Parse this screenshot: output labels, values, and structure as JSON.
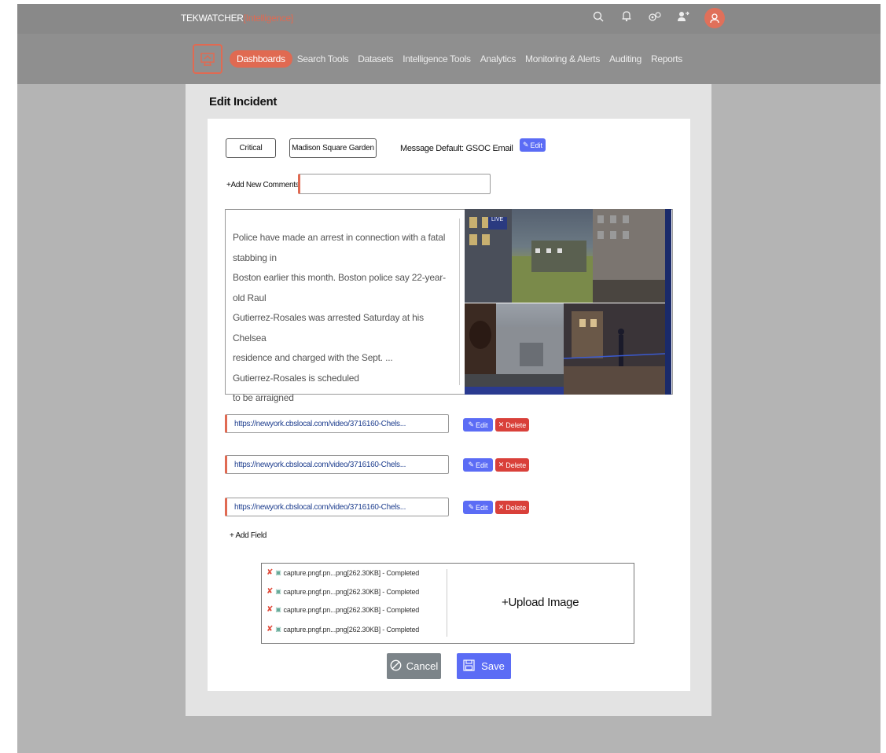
{
  "app": {
    "brand": "TEKWATCHER",
    "brand_suffix": "[Intelligence]"
  },
  "top_icons": [
    "search-icon",
    "bell-icon",
    "settings-icon",
    "user-switch-icon",
    "user-avatar-icon"
  ],
  "nav": {
    "items": [
      {
        "label": "Dashboards",
        "active": true
      },
      {
        "label": "Search Tools"
      },
      {
        "label": "Datasets"
      },
      {
        "label": "Intelligence Tools"
      },
      {
        "label": "Analytics"
      },
      {
        "label": "Monitoring & Alerts"
      },
      {
        "label": "Auditing"
      },
      {
        "label": "Reports"
      }
    ]
  },
  "page": {
    "title": "Edit Incident"
  },
  "incident": {
    "severity": "Critical",
    "location": "Madison Square Garden",
    "message_default": "Message Default: GSOC Email",
    "edit_label": "Edit",
    "add_comments_label": "Add New Comments",
    "comment_value": "",
    "news_lines": [
      "Police have made an arrest in connection with a fatal stabbing in",
      "Boston earlier this month. Boston police say 22-year-old Raul",
      "Gutierrez-Rosales was arrested Saturday at his Chelsea",
      "residence and charged with the Sept. ...",
      "Gutierrez-Rosales is scheduled",
      "to be arraigned"
    ],
    "thumb_overlay": "LIVE"
  },
  "links": [
    {
      "url": "https://newyork.cbslocal.com/video/3716160-Chels...",
      "edit": "Edit",
      "delete": "Delete"
    },
    {
      "url": "https://newyork.cbslocal.com/video/3716160-Chels...",
      "edit": "Edit",
      "delete": "Delete"
    },
    {
      "url": "https://newyork.cbslocal.com/video/3716160-Chels...",
      "edit": "Edit",
      "delete": "Delete"
    }
  ],
  "add_field_label": "Add Field",
  "uploads": {
    "files": [
      "capture.pngf.pn...png[262.30KB] - Completed",
      "capture.pngf.pn...png[262.30KB] - Completed",
      "capture.pngf.pn...png[262.30KB] - Completed",
      "capture.pngf.pn...png[262.30KB] - Completed"
    ],
    "upload_label": "Upload Image"
  },
  "actions": {
    "cancel": "Cancel",
    "save": "Save"
  },
  "colors": {
    "accent": "#e06a52",
    "primary": "#5b6cf5",
    "danger": "#d9403a",
    "neutral": "#7c8489"
  }
}
